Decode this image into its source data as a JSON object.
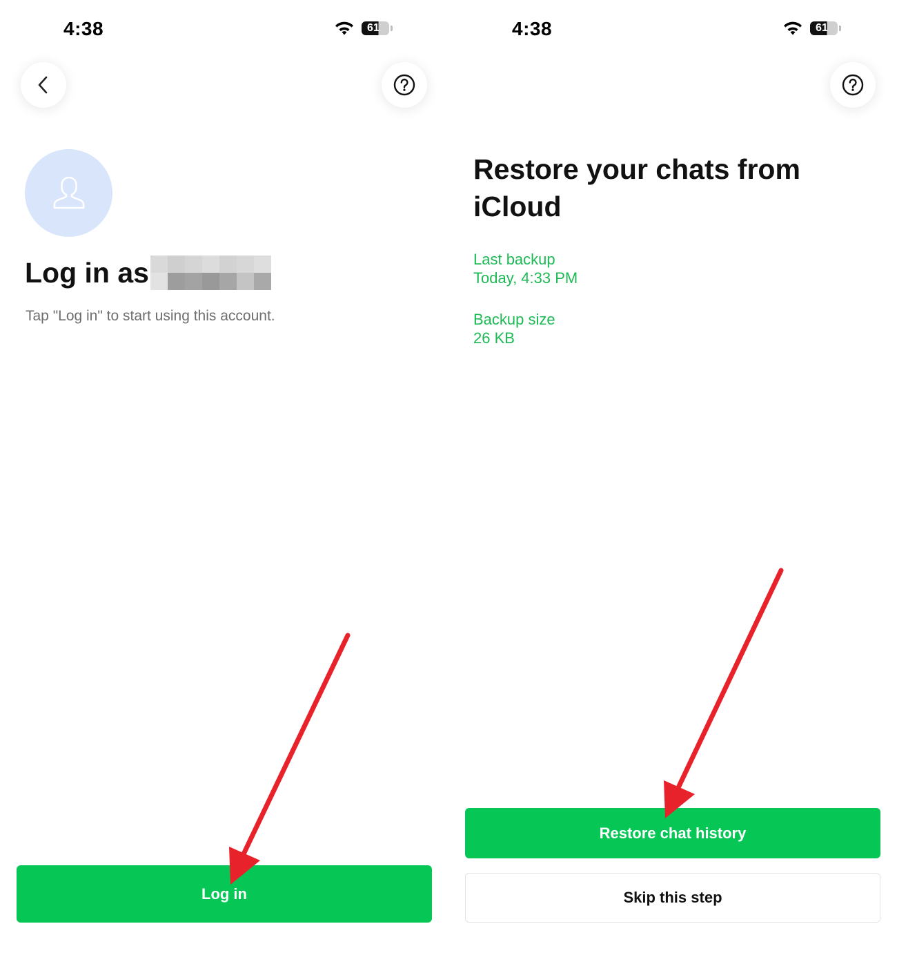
{
  "colors": {
    "brand_green": "#06c755",
    "info_green": "#1db954",
    "avatar_bg": "#d8e5fb",
    "annotation_red": "#e8222b"
  },
  "left_screen": {
    "status_bar": {
      "time": "4:38",
      "battery": "61",
      "icons": [
        "wifi-icon",
        "battery-icon"
      ]
    },
    "back_icon": "chevron-left-icon",
    "help_icon": "question-circle-icon",
    "avatar_icon": "person-outline-icon",
    "title": "Log in as",
    "title_name_redacted": true,
    "subtitle": "Tap \"Log in\" to start using this account.",
    "login_button": "Log in"
  },
  "right_screen": {
    "status_bar": {
      "time": "4:38",
      "battery": "61",
      "icons": [
        "wifi-icon",
        "battery-icon"
      ]
    },
    "help_icon": "question-circle-icon",
    "title": "Restore your chats from iCloud",
    "last_backup_label": "Last backup",
    "last_backup_value": "Today, 4:33 PM",
    "backup_size_label": "Backup size",
    "backup_size_value": "26 KB",
    "restore_button": "Restore chat history",
    "skip_button": "Skip this step"
  }
}
